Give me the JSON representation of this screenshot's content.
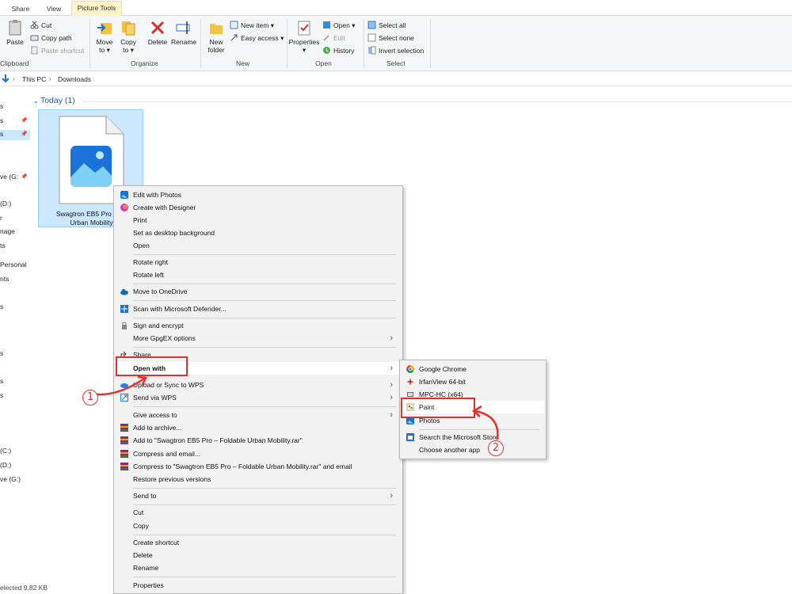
{
  "ribbon_tabs": [
    "Share",
    "View",
    "Picture Tools"
  ],
  "ribbon": {
    "clipboard": {
      "paste": "Paste",
      "cut": "Cut",
      "copy_path": "Copy path",
      "paste_shortcut": "Paste shortcut",
      "group": "Clipboard"
    },
    "organize": {
      "move_to": "Move to ▾",
      "copy_to": "Copy to ▾",
      "delete": "Delete",
      "rename": "Rename",
      "group": "Organize"
    },
    "new": {
      "new_folder": "New folder",
      "new_item": "New item ▾",
      "easy_access": "Easy access ▾",
      "group": "New"
    },
    "open": {
      "properties": "Properties",
      "open": "Open ▾",
      "edit": "Edit",
      "history": "History",
      "group": "Open"
    },
    "select": {
      "select_all": "Select all",
      "select_none": "Select none",
      "invert_selection": "Invert selection",
      "group": "Select"
    }
  },
  "address": {
    "crumb1": "This PC",
    "crumb2": "Downloads"
  },
  "nav_items": [
    "s",
    "s",
    "s",
    "",
    "",
    "ve (G:",
    "(D:)",
    "r",
    "nage",
    "ts",
    "Personal",
    "nts",
    "s",
    "s",
    "s",
    "s",
    "(C:)",
    "(D:)",
    "ve (G:)"
  ],
  "content": {
    "group_header": "Today (1)",
    "file_name_line1": "Swagtron EB5 Pro – Fo",
    "file_name_line2": "Urban Mobility"
  },
  "status": "elected  9.82 KB",
  "context_menu": {
    "items": [
      "Edit with Photos",
      "Create with Designer",
      "Print",
      "Set as desktop background",
      "Open",
      "Rotate right",
      "Rotate left",
      "Move to OneDrive",
      "Scan with Microsoft Defender...",
      "Sign and encrypt",
      "More GpgEX options",
      "Share",
      "Open with",
      "Upload or Sync to WPS",
      "Send via WPS",
      "Give access to",
      "Add to archive...",
      "Add to \"Swagtron EB5 Pro – Foldable Urban Mobility.rar\"",
      "Compress and email...",
      "Compress to \"Swagtron EB5 Pro – Foldable Urban Mobility.rar\" and email",
      "Restore previous versions",
      "Send to",
      "Cut",
      "Copy",
      "Create shortcut",
      "Delete",
      "Rename",
      "Properties"
    ]
  },
  "open_with_menu": {
    "items": [
      "Google Chrome",
      "IrfanView 64-bit",
      "MPC-HC (x64)",
      "Paint",
      "Photos",
      "Search the Microsoft Store",
      "Choose another app"
    ]
  },
  "annotations": {
    "step1": "1",
    "step2": "2"
  },
  "colors": {
    "accent_red": "#e03131",
    "selection": "#cce8ff",
    "ribbon_bg": "#f5f6f7",
    "menu_bg": "#f2f2f2"
  }
}
